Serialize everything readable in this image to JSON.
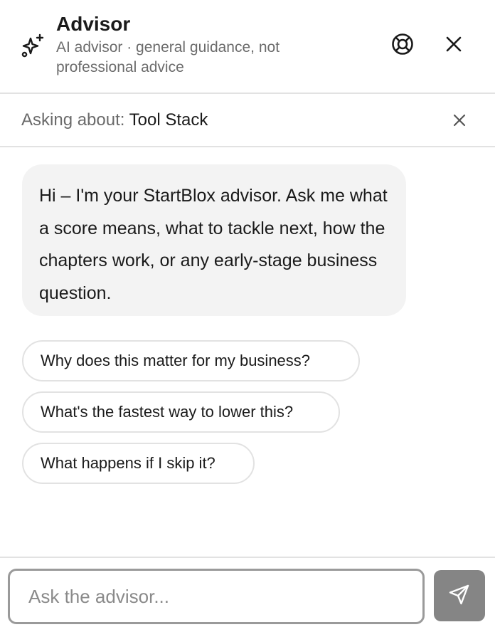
{
  "header": {
    "title": "Advisor",
    "subtitle": "AI advisor · general guidance, not professional advice",
    "icon": "sparkle-icon",
    "help_icon": "lifebuoy-icon",
    "close_icon": "close-icon"
  },
  "context": {
    "label": "Asking about:",
    "topic": "Tool Stack",
    "clear_icon": "close-icon"
  },
  "messages": [
    {
      "role": "assistant",
      "text": "Hi – I'm your StartBlox advisor. Ask me what a score means, what to tackle next, how the chapters work, or any early-stage business question."
    }
  ],
  "suggestions": [
    "Why does this matter for my business?",
    "What's the fastest way to lower this?",
    "What happens if I skip it?"
  ],
  "composer": {
    "placeholder": "Ask the advisor...",
    "value": "",
    "send_icon": "send-icon"
  },
  "colors": {
    "bubble_bg": "#f3f3f3",
    "send_bg": "#858585",
    "muted_text": "#6b6b6b",
    "border": "#e2e2e2"
  }
}
